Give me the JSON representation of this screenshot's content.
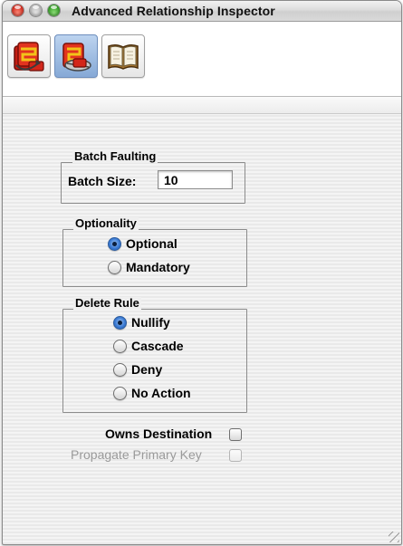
{
  "window": {
    "title": "Advanced Relationship Inspector"
  },
  "toolbar": {
    "buttons": [
      {
        "icon": "entity-model-icon",
        "selected": false
      },
      {
        "icon": "relationship-model-icon",
        "selected": true
      },
      {
        "icon": "book-icon",
        "selected": false
      }
    ]
  },
  "batch_faulting": {
    "group_label": "Batch Faulting",
    "batch_size_label": "Batch Size:",
    "batch_size_value": "10"
  },
  "optionality": {
    "group_label": "Optionality",
    "options": [
      {
        "label": "Optional",
        "selected": true
      },
      {
        "label": "Mandatory",
        "selected": false
      }
    ]
  },
  "delete_rule": {
    "group_label": "Delete Rule",
    "options": [
      {
        "label": "Nullify",
        "selected": true
      },
      {
        "label": "Cascade",
        "selected": false
      },
      {
        "label": "Deny",
        "selected": false
      },
      {
        "label": "No Action",
        "selected": false
      }
    ]
  },
  "owns_destination": {
    "label": "Owns Destination",
    "checked": false,
    "enabled": true
  },
  "propagate_primary_key": {
    "label": "Propagate Primary Key",
    "checked": false,
    "enabled": false
  }
}
